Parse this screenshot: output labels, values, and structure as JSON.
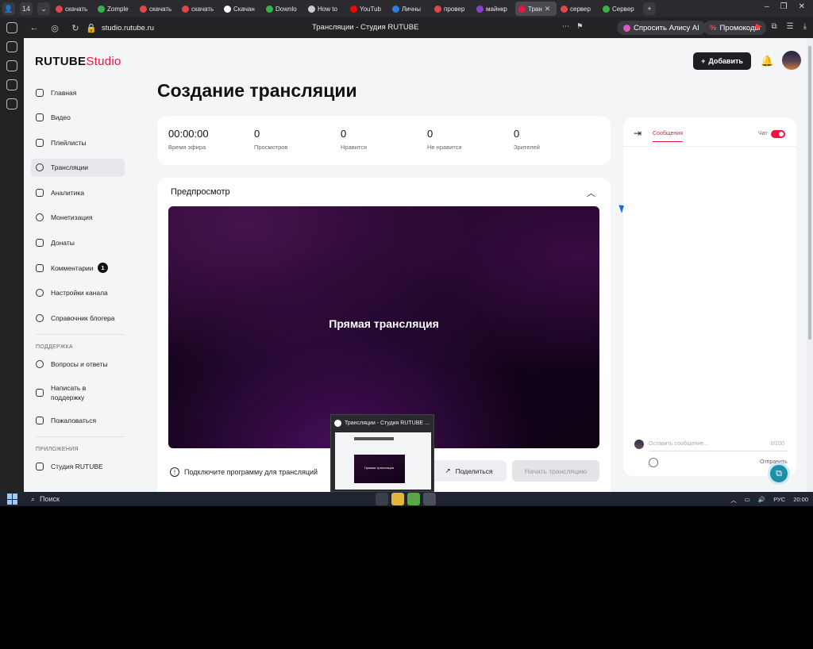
{
  "browser": {
    "tabs": [
      {
        "label": "скачать",
        "color": "#e04848"
      },
      {
        "label": "Zomple",
        "color": "#38b34a"
      },
      {
        "label": "скачать",
        "color": "#e04848"
      },
      {
        "label": "скачать",
        "color": "#e04848"
      },
      {
        "label": "Скачан",
        "color": "#ffffff"
      },
      {
        "label": "Downlo",
        "color": "#38b34a"
      },
      {
        "label": "How to",
        "color": "#cccccc"
      },
      {
        "label": "YouTub",
        "color": "#ff0000"
      },
      {
        "label": "Личны",
        "color": "#2f7fe0"
      },
      {
        "label": "провер",
        "color": "#e04848"
      },
      {
        "label": "майнкр",
        "color": "#8a3fd0"
      },
      {
        "label": "Тран",
        "color": "#ed143d",
        "active": true
      },
      {
        "label": "сервер",
        "color": "#e04848"
      },
      {
        "label": "Сервер",
        "color": "#38b34a"
      }
    ],
    "tab_count": "14",
    "url": "studio.rutube.ru",
    "page_title": "Трансляции - Студия RUTUBE",
    "alice_label": "Спросить Алису AI",
    "promo_label": "Промокоды"
  },
  "studio": {
    "logo_main": "RUTUBE",
    "logo_studio": "Studio",
    "add_button": "Добавить",
    "sidebar": [
      {
        "label": "Главная",
        "name": "home"
      },
      {
        "label": "Видео",
        "name": "video"
      },
      {
        "label": "Плейлисты",
        "name": "playlists"
      },
      {
        "label": "Трансляции",
        "name": "streams",
        "active": true
      },
      {
        "label": "Аналитика",
        "name": "analytics"
      },
      {
        "label": "Монетизация",
        "name": "monetization"
      },
      {
        "label": "Донаты",
        "name": "donations"
      },
      {
        "label": "Комментарии",
        "name": "comments",
        "badge": "1"
      },
      {
        "label": "Настройки канала",
        "name": "channel-settings"
      },
      {
        "label": "Справочник блогера",
        "name": "blogger-guide"
      }
    ],
    "support_title": "ПОДДЕРЖКА",
    "support_items": [
      {
        "label": "Вопросы и ответы",
        "name": "faq"
      },
      {
        "label": "Написать в поддержку",
        "name": "write-support"
      },
      {
        "label": "Пожаловаться",
        "name": "report"
      }
    ],
    "apps_title": "ПРИЛОЖЕНИЯ",
    "apps_items": [
      {
        "label": "Студия RUTUBE",
        "name": "studio-app"
      }
    ],
    "page_title": "Создание трансляции",
    "stats": [
      {
        "value": "00:00:00",
        "label": "Время эфира"
      },
      {
        "value": "0",
        "label": "Просмотров"
      },
      {
        "value": "0",
        "label": "Нравится"
      },
      {
        "value": "0",
        "label": "Не нравится"
      },
      {
        "value": "0",
        "label": "Зрителей"
      }
    ],
    "preview": {
      "title": "Предпросмотр",
      "video_text": "Прямая трансляция",
      "hint": "Подключите программу для трансляций",
      "share_button": "Поделиться",
      "start_button": "Начать трансляцию"
    },
    "chat": {
      "tab_label": "Сообщения",
      "toggle_label": "Чат",
      "placeholder": "Оставить сообщение...",
      "counter": "0/200",
      "send_label": "Отправить"
    }
  },
  "popup": {
    "title": "Трансляции - Студия RUTUBE ...",
    "thumb_text": "Прямая трансляция"
  },
  "taskbar": {
    "search": "Поиск",
    "lang": "РУС",
    "time": "20:00"
  }
}
